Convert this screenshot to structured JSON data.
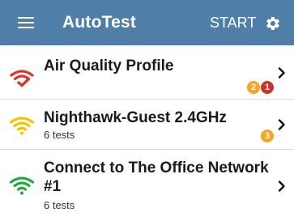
{
  "appbar": {
    "title": "AutoTest",
    "start_label": "START"
  },
  "colors": {
    "appbar_bg": "#4f7ea8",
    "wifi_red": "#e0312b",
    "wifi_yellow": "#f5c200",
    "wifi_green": "#22a93c",
    "badge_orange": "#f5a623",
    "badge_red": "#d0302a"
  },
  "profiles": [
    {
      "title": "Air Quality Profile",
      "subtitle": "",
      "icon": "wifi-red-check-icon",
      "badges": [
        {
          "count": "2",
          "color": "orange"
        },
        {
          "count": "1",
          "color": "red"
        }
      ]
    },
    {
      "title": "Nighthawk-Guest 2.4GHz",
      "subtitle": "6 tests",
      "icon": "wifi-yellow-icon",
      "badges": [
        {
          "count": "3",
          "color": "orange"
        }
      ]
    },
    {
      "title_line1": "Connect to The Office Network",
      "title_line2": "#1",
      "subtitle": "6 tests",
      "icon": "wifi-green-icon",
      "badges": []
    }
  ]
}
